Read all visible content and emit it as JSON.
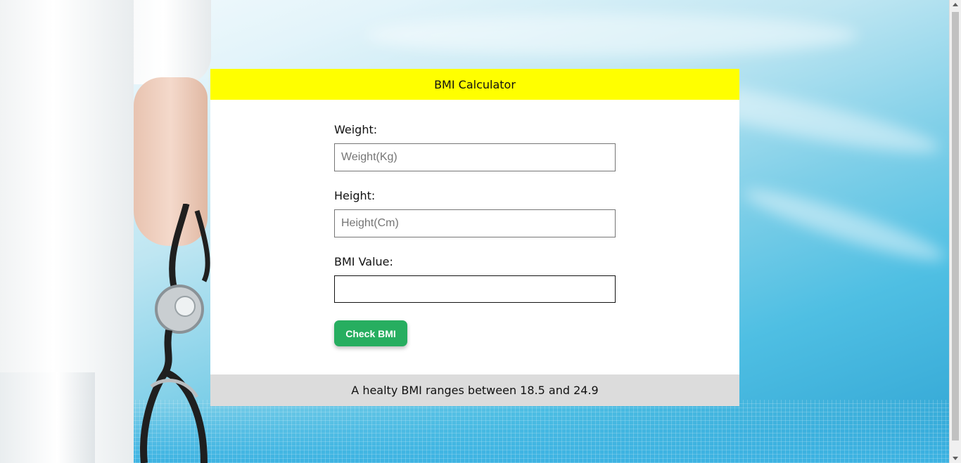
{
  "card": {
    "title": "BMI Calculator",
    "footer_text": "A healty BMI ranges between 18.5 and 24.9"
  },
  "form": {
    "weight": {
      "label": "Weight:",
      "placeholder": "Weight(Kg)",
      "value": ""
    },
    "height": {
      "label": "Height:",
      "placeholder": "Height(Cm)",
      "value": ""
    },
    "bmi": {
      "label": "BMI Value:",
      "value": ""
    },
    "check_button_label": "Check BMI"
  },
  "colors": {
    "header_bg": "#ffff00",
    "button_bg": "#27ae60",
    "footer_bg": "#dcdcdc"
  }
}
